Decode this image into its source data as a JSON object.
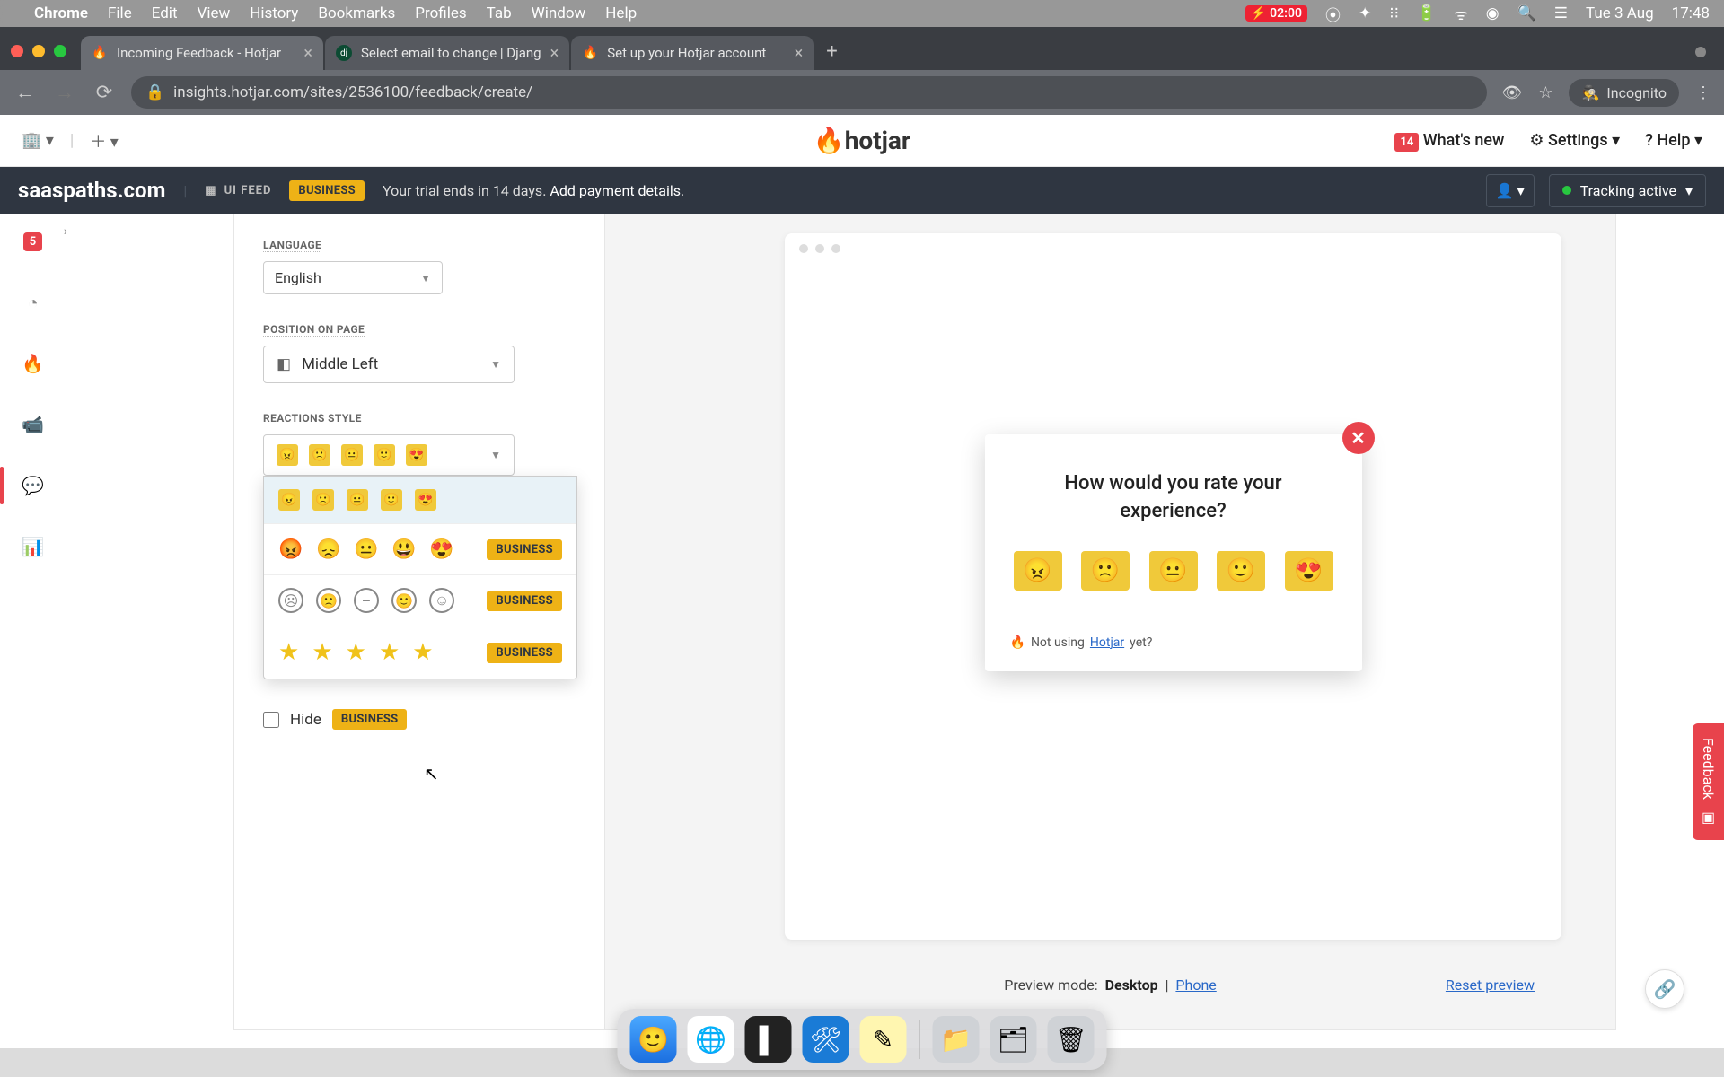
{
  "mac_menu": {
    "app": "Chrome",
    "items": [
      "File",
      "Edit",
      "View",
      "History",
      "Bookmarks",
      "Profiles",
      "Tab",
      "Window",
      "Help"
    ],
    "battery": "02:00",
    "date": "Tue 3 Aug",
    "time": "17:48"
  },
  "tabs": [
    {
      "title": "Incoming Feedback - Hotjar",
      "active": true
    },
    {
      "title": "Select email to change | Djang",
      "active": false
    },
    {
      "title": "Set up your Hotjar account",
      "active": false
    }
  ],
  "url": "insights.hotjar.com/sites/2536100/feedback/create/",
  "incognito": "Incognito",
  "app_header": {
    "whats_new_count": "14",
    "whats_new": "What's new",
    "settings": "Settings",
    "help": "Help",
    "logo": "hotjar"
  },
  "site_bar": {
    "site_name": "saaspaths.com",
    "ui_feed": "UI FEED",
    "plan_badge": "BUSINESS",
    "trial_text": "Your trial ends in 14 days.",
    "trial_link": "Add payment details",
    "tracking": "Tracking active"
  },
  "sidebar_badge": "5",
  "config": {
    "language_label": "LANGUAGE",
    "language_value": "English",
    "position_label": "POSITION ON PAGE",
    "position_value": "Middle Left",
    "reactions_label": "REACTIONS STYLE",
    "hide_label": "Hide",
    "biz_badge": "BUSINESS"
  },
  "reactions_options": {
    "option1_badge": "",
    "option2_badge": "BUSINESS",
    "option3_badge": "BUSINESS",
    "option4_badge": "BUSINESS"
  },
  "preview": {
    "question": "How would you rate your experience?",
    "footer_pre": "Not using",
    "footer_link": "Hotjar",
    "footer_post": "yet?",
    "mode_label": "Preview mode:",
    "mode_desktop": "Desktop",
    "mode_phone": "Phone",
    "reset": "Reset preview"
  },
  "feedback_tab": "Feedback"
}
